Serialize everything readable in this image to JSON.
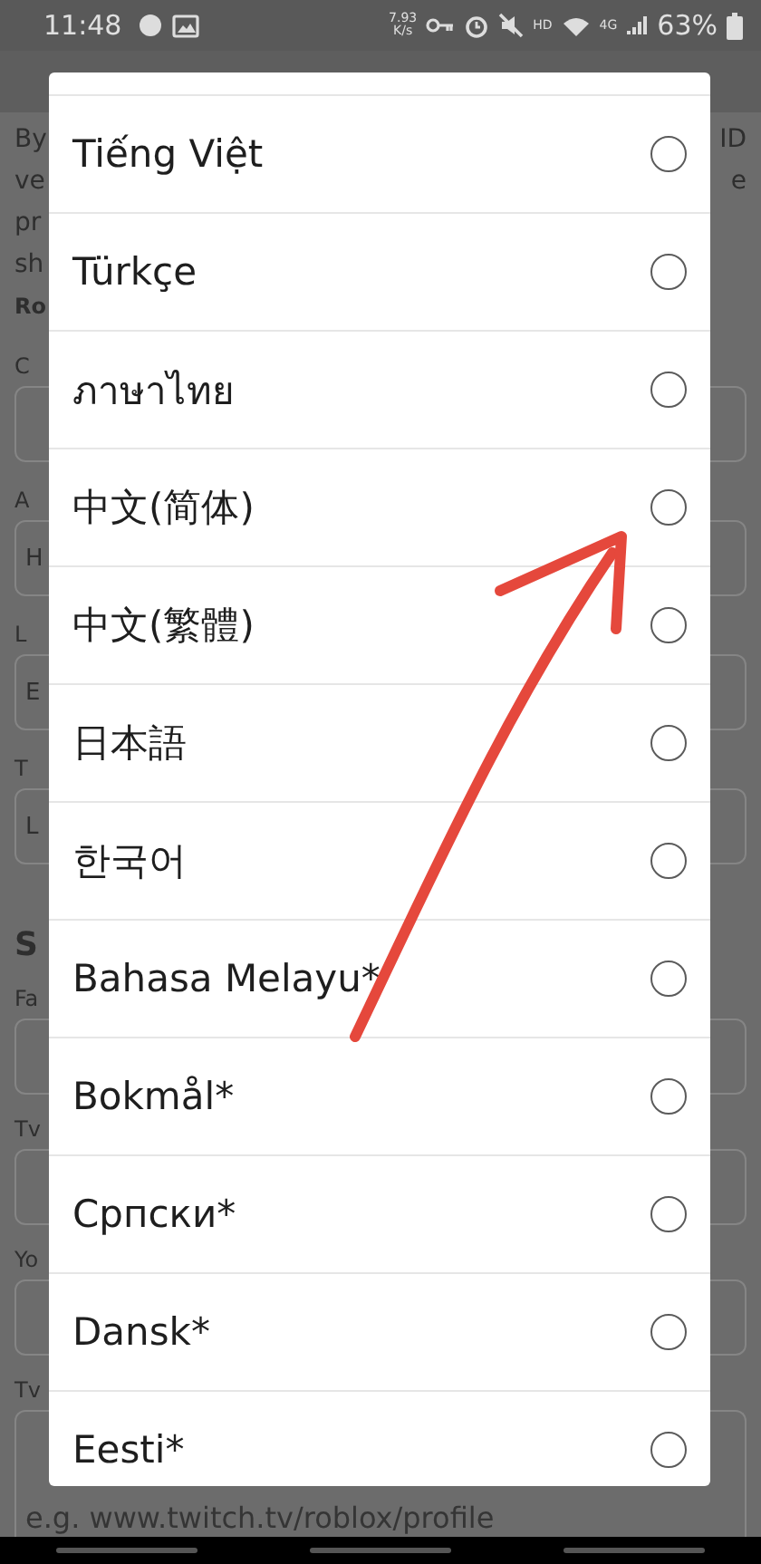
{
  "status_bar": {
    "time": "11:48",
    "speed": "7.93",
    "speed_unit": "K/s",
    "hd": "HD",
    "network": "4G",
    "battery": "63%"
  },
  "background": {
    "intro_fragments": [
      "By",
      "ve",
      "pr",
      "sh"
    ],
    "bold_fragment": "Ro",
    "right_fragments": [
      "ID",
      "e"
    ],
    "upper_fields": [
      {
        "label": "C"
      },
      {
        "label": "A",
        "value": "H"
      },
      {
        "label": "L",
        "value": "E"
      },
      {
        "label": "T",
        "value": "L"
      }
    ],
    "section_heading": "S",
    "lower_fields": [
      {
        "label": "Fa"
      },
      {
        "label": "Tv"
      },
      {
        "label": "Yo"
      },
      {
        "label": "Tv",
        "placeholder": "e.g. www.twitch.tv/roblox/profile"
      }
    ]
  },
  "language_dialog": {
    "options": [
      {
        "label": "Tiếng Việt",
        "selected": false
      },
      {
        "label": "Türkçe",
        "selected": false
      },
      {
        "label": "ภาษาไทย",
        "selected": false
      },
      {
        "label": "中文(简体)",
        "selected": false
      },
      {
        "label": "中文(繁體)",
        "selected": false
      },
      {
        "label": "日本語",
        "selected": false
      },
      {
        "label": "한국어",
        "selected": false
      },
      {
        "label": "Bahasa Melayu*",
        "selected": false
      },
      {
        "label": "Bokmål*",
        "selected": false
      },
      {
        "label": "Српски*",
        "selected": false
      },
      {
        "label": "Dansk*",
        "selected": false
      },
      {
        "label": "Eesti*",
        "selected": false
      }
    ]
  }
}
